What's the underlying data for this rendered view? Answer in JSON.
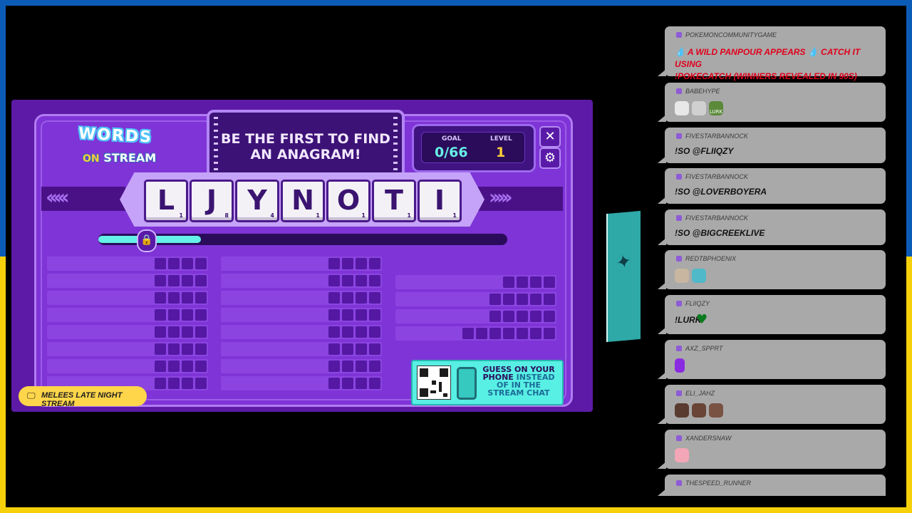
{
  "game": {
    "logo_words": "WORDS",
    "logo_on": "ON",
    "logo_stream": "STREAM",
    "title_line1": "BE THE FIRST TO FIND",
    "title_line2": "AN ANAGRAM!",
    "goal_label": "GOAL",
    "goal_value": "0/66",
    "level_label": "LEVEL",
    "level_value": "1",
    "close_label": "✕",
    "settings_label": "⚙",
    "tiles": [
      {
        "letter": "L",
        "points": "1"
      },
      {
        "letter": "J",
        "points": "8"
      },
      {
        "letter": "Y",
        "points": "4"
      },
      {
        "letter": "N",
        "points": "1"
      },
      {
        "letter": "O",
        "points": "1"
      },
      {
        "letter": "T",
        "points": "1"
      },
      {
        "letter": "I",
        "points": "1"
      }
    ],
    "progress_fraction": 0.25,
    "qr_line1": "GUESS ON YOUR",
    "qr_line2a": "PHONE",
    "qr_line2b": "INSTEAD",
    "qr_line3": "OF IN THE",
    "qr_line4": "STREAM CHAT",
    "stream_label": "MELEES LATE NIGHT STREAM"
  },
  "chat": [
    {
      "user": "POKEMONCOMMUNITYGAME",
      "text1": "A WILD PANPOUR APPEARS",
      "text2": "CATCH IT USING",
      "text3": "!POKECATCH (WINNERS REVEALED IN 90S)"
    },
    {
      "user": "BABEHYPE",
      "text": ""
    },
    {
      "user": "FIVESTARBANNOCK",
      "text": "!SO @FLIIQZY"
    },
    {
      "user": "FIVESTARBANNOCK",
      "text": "!SO @LOVERBOYERA"
    },
    {
      "user": "FIVESTARBANNOCK",
      "text": "!SO @BIGCREEKLIVE"
    },
    {
      "user": "REDTBPHOENIX",
      "text": ""
    },
    {
      "user": "FLIIQZY",
      "text": "!LURK"
    },
    {
      "user": "AXZ_SPPRT",
      "text": ""
    },
    {
      "user": "ELI_JAHZ",
      "text": ""
    },
    {
      "user": "XANDERSNAW",
      "text": ""
    },
    {
      "user": "THESPEED_RUNNER",
      "text": ""
    }
  ],
  "emotes": {
    "lurk_text": "LURK",
    "heart_icon": "heart-icon"
  },
  "colors": {
    "frame_blue": "#0b5bb7",
    "frame_yellow": "#f6d10a",
    "panel_purple": "#7e34d6",
    "accent_cyan": "#58efe4",
    "chat_bubble": "#a9a9a9",
    "chat_alert_red": "#e0001b"
  }
}
